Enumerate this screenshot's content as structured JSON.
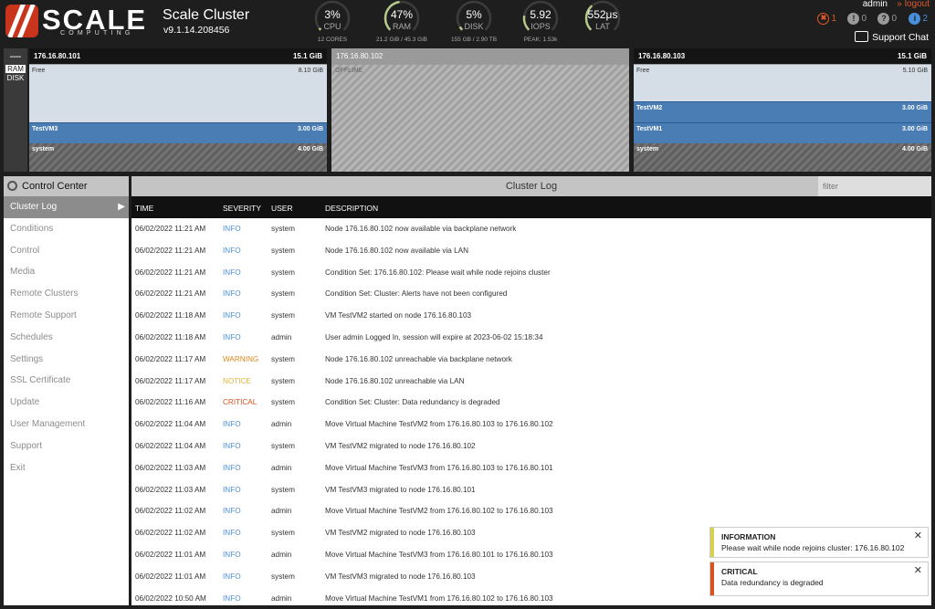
{
  "brand": {
    "name": "SCALE",
    "tagline": "COMPUTING",
    "accent": "#c8341c"
  },
  "cluster": {
    "name": "Scale Cluster",
    "version": "v9.1.14.208456"
  },
  "gauges": [
    {
      "value": "3%",
      "label": "CPU",
      "sub": "12 CORES",
      "fraction": 0.03
    },
    {
      "value": "47%",
      "label": "RAM",
      "sub": "21.2 GiB / 45.3 GiB",
      "fraction": 0.47
    },
    {
      "value": "5%",
      "label": "DISK",
      "sub": "155 GB / 2.90 TB",
      "fraction": 0.05
    },
    {
      "value": "5.92",
      "label": "IOPS",
      "sub": "PEAK: 1.53k",
      "fraction": 0.2
    },
    {
      "value": "552μs",
      "label": "LAT",
      "sub": "",
      "fraction": 0.35
    }
  ],
  "user": {
    "name": "admin",
    "logout": "» logout"
  },
  "alerts": [
    {
      "icon": "error-icon",
      "glyph": "✖",
      "count": "1",
      "color": "#e05a2b"
    },
    {
      "icon": "warning-icon",
      "glyph": "!",
      "count": "0",
      "color": "#9a9a9a"
    },
    {
      "icon": "question-icon",
      "glyph": "?",
      "count": "0",
      "color": "#9a9a9a"
    },
    {
      "icon": "info-icon",
      "glyph": "i",
      "count": "2",
      "color": "#4a8fdb"
    }
  ],
  "support_chat": "Support Chat",
  "view_toggle": {
    "collapse": "—",
    "ram": "RAM",
    "disk": "DISK"
  },
  "nodes": [
    {
      "ip": "176.16.80.101",
      "capacity": "15.1 GiB",
      "offline": false,
      "segments": [
        {
          "kind": "free",
          "label": "Free",
          "size": "8.10 GiB",
          "fraction": 0.54
        },
        {
          "kind": "vm",
          "label": "TestVM3",
          "size": "3.00 GiB",
          "fraction": 0.2
        },
        {
          "kind": "sys",
          "label": "system",
          "size": "4.00 GiB",
          "fraction": 0.26
        }
      ]
    },
    {
      "ip": "176.16.80.102",
      "capacity": "",
      "offline": true,
      "offline_label": "OFFLINE",
      "segments": []
    },
    {
      "ip": "176.16.80.103",
      "capacity": "15.1 GiB",
      "offline": false,
      "segments": [
        {
          "kind": "free",
          "label": "Free",
          "size": "5.10 GiB",
          "fraction": 0.34
        },
        {
          "kind": "vm",
          "label": "TestVM2",
          "size": "3.00 GiB",
          "fraction": 0.2
        },
        {
          "kind": "vm",
          "label": "TestVM1",
          "size": "3.00 GiB",
          "fraction": 0.2
        },
        {
          "kind": "sys",
          "label": "system",
          "size": "4.00 GiB",
          "fraction": 0.26
        }
      ]
    }
  ],
  "sidebar": {
    "title": "Control Center",
    "items": [
      "Cluster Log",
      "Conditions",
      "Control",
      "Media",
      "Remote Clusters",
      "Remote Support",
      "Schedules",
      "Settings",
      "SSL Certificate",
      "Update",
      "User Management",
      "Support",
      "Exit"
    ],
    "active": 0
  },
  "log": {
    "title": "Cluster Log",
    "filter_placeholder": "filter",
    "columns": [
      "TIME",
      "SEVERITY",
      "USER",
      "DESCRIPTION"
    ],
    "severity_colors": {
      "INFO": "#4a8fdb",
      "WARNING": "#d98a1e",
      "NOTICE": "#e0b43a",
      "CRITICAL": "#d4531e"
    },
    "rows": [
      [
        "06/02/2022 11:21 AM",
        "INFO",
        "system",
        "Node 176.16.80.102 now available via backplane network"
      ],
      [
        "06/02/2022 11:21 AM",
        "INFO",
        "system",
        "Node 176.16.80.102 now available via LAN"
      ],
      [
        "06/02/2022 11:21 AM",
        "INFO",
        "system",
        "Condition Set: 176.16.80.102: Please wait while node rejoins cluster"
      ],
      [
        "06/02/2022 11:21 AM",
        "INFO",
        "system",
        "Condition Set: Cluster: Alerts have not been configured"
      ],
      [
        "06/02/2022 11:18 AM",
        "INFO",
        "system",
        "VM TestVM2 started on node 176.16.80.103"
      ],
      [
        "06/02/2022 11:18 AM",
        "INFO",
        "admin",
        "User admin Logged In, session will expire at 2023-06-02 15:18:34"
      ],
      [
        "06/02/2022 11:17 AM",
        "WARNING",
        "system",
        "Node 176.16.80.102 unreachable via backplane network"
      ],
      [
        "06/02/2022 11:17 AM",
        "NOTICE",
        "system",
        "Node 176.16.80.102 unreachable via LAN"
      ],
      [
        "06/02/2022 11:16 AM",
        "CRITICAL",
        "system",
        "Condition Set: Cluster: Data redundancy is degraded"
      ],
      [
        "06/02/2022 11:04 AM",
        "INFO",
        "admin",
        "Move Virtual Machine TestVM2 from 176.16.80.103 to 176.16.80.102"
      ],
      [
        "06/02/2022 11:04 AM",
        "INFO",
        "system",
        "VM TestVM2 migrated to node 176.16.80.102"
      ],
      [
        "06/02/2022 11:03 AM",
        "INFO",
        "admin",
        "Move Virtual Machine TestVM3 from 176.16.80.103 to 176.16.80.101"
      ],
      [
        "06/02/2022 11:03 AM",
        "INFO",
        "system",
        "VM TestVM3 migrated to node 176.16.80.101"
      ],
      [
        "06/02/2022 11:02 AM",
        "INFO",
        "admin",
        "Move Virtual Machine TestVM2 from 176.16.80.102 to 176.16.80.103"
      ],
      [
        "06/02/2022 11:02 AM",
        "INFO",
        "system",
        "VM TestVM2 migrated to node 176.16.80.103"
      ],
      [
        "06/02/2022 11:01 AM",
        "INFO",
        "admin",
        "Move Virtual Machine TestVM3 from 176.16.80.101 to 176.16.80.103"
      ],
      [
        "06/02/2022 11:01 AM",
        "INFO",
        "system",
        "VM TestVM3 migrated to node 176.16.80.103"
      ],
      [
        "06/02/2022 10:50 AM",
        "INFO",
        "admin",
        "Move Virtual Machine TestVM1 from 176.16.80.102 to 176.16.80.103"
      ]
    ]
  },
  "notifications": [
    {
      "title": "INFORMATION",
      "message": "Please wait while node rejoins cluster: 176.16.80.102",
      "color": "#d8d050",
      "close": "✕"
    },
    {
      "title": "CRITICAL",
      "message": "Data redundancy is degraded",
      "color": "#d4531e",
      "close": "✕"
    }
  ]
}
